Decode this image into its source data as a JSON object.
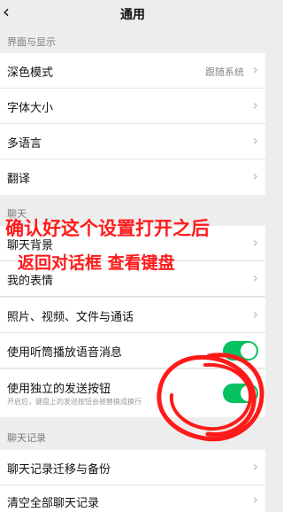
{
  "header": {
    "title": "通用",
    "back_icon": "back-arrow-icon"
  },
  "sections": {
    "display": {
      "header": "界面与显示"
    },
    "chat": {
      "header": "聊天"
    },
    "history": {
      "header": "聊天记录"
    }
  },
  "rows": {
    "dark_mode": {
      "label": "深色模式",
      "value": "跟随系统"
    },
    "font_size": {
      "label": "字体大小"
    },
    "language": {
      "label": "多语言"
    },
    "translate": {
      "label": "翻译"
    },
    "chat_background": {
      "label": "聊天背景"
    },
    "my_stickers": {
      "label": "我的表情"
    },
    "media_files": {
      "label": "照片、视频、文件与通话"
    },
    "earpiece": {
      "label": "使用听筒播放语音消息",
      "enabled": true
    },
    "send_button": {
      "label": "使用独立的发送按钮",
      "sublabel": "开启后，键盘上的发送按钮会被替换成换行",
      "enabled": true
    },
    "migrate": {
      "label": "聊天记录迁移与备份"
    },
    "clear_all": {
      "label": "清空全部聊天记录"
    }
  },
  "annotation": {
    "line1": "确认好这个设置打开之后",
    "line2": "返回对话框  查看键盘",
    "color": "#ff1a1a"
  },
  "colors": {
    "toggle_on": "#07c160",
    "background": "#ededed"
  }
}
